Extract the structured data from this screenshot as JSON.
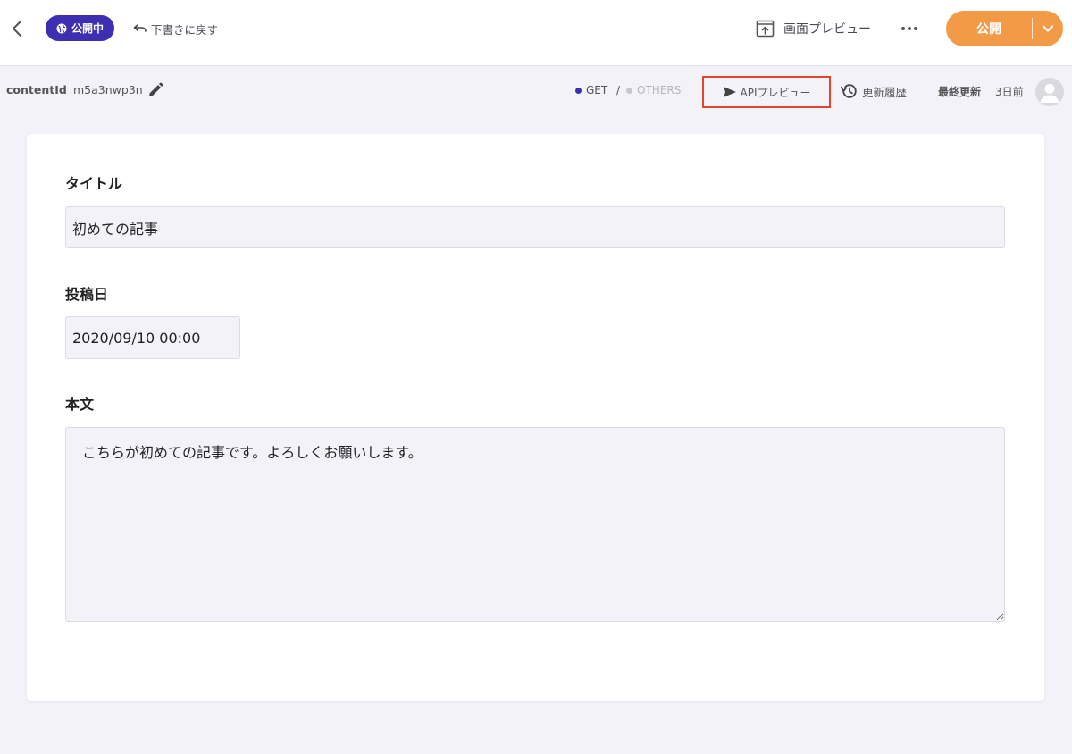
{
  "header": {
    "status_badge": "公開中",
    "revert_label": "下書きに戻す",
    "screen_preview_label": "画面プレビュー",
    "publish_label": "公開"
  },
  "subbar": {
    "content_id_label": "contentId",
    "content_id_value": "m5a3nwp3n",
    "method_get": "GET",
    "method_separator": "/",
    "method_others": "OTHERS",
    "api_preview_label": "APIプレビュー",
    "history_label": "更新履歴",
    "last_updated_label": "最終更新",
    "last_updated_value": "3日前"
  },
  "form": {
    "title_label": "タイトル",
    "title_value": "初めての記事",
    "date_label": "投稿日",
    "date_value": "2020/09/10 00:00",
    "body_label": "本文",
    "body_value": "こちらが初めての記事です。よろしくお願いします。"
  },
  "colors": {
    "brand_purple": "#3d2eb2",
    "publish_orange": "#f29a46",
    "highlight_red": "#e2452c",
    "page_background": "#f3f2f8"
  },
  "icons": {
    "back": "chevron-left-icon",
    "globe": "globe-icon",
    "revert": "undo-icon",
    "screen_preview": "preview-window-icon",
    "more": "more-horizontal-icon",
    "caret": "chevron-down-icon",
    "edit": "pencil-icon",
    "send": "send-icon",
    "history": "history-icon",
    "avatar": "user-avatar-icon"
  }
}
